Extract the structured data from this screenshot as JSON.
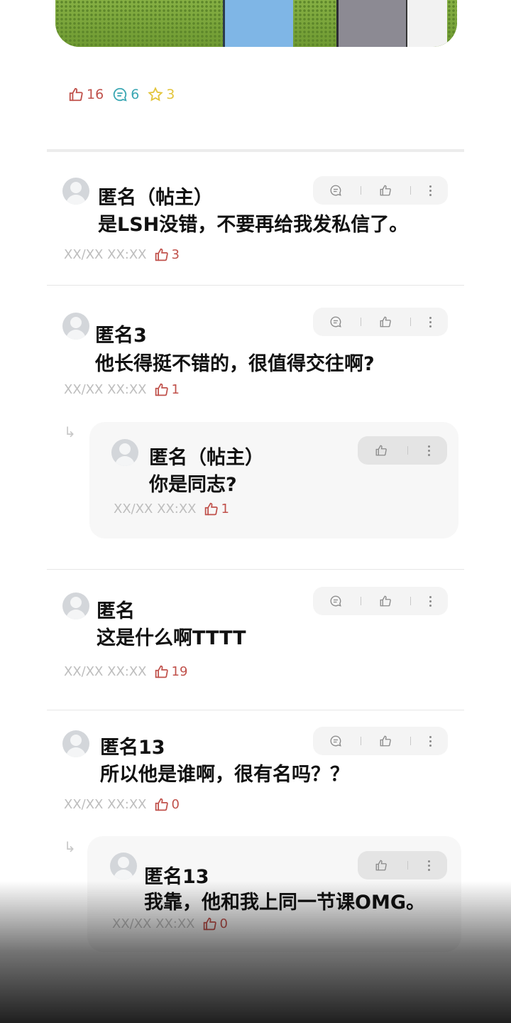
{
  "post_stats": {
    "likes": "16",
    "comments": "6",
    "stars": "3"
  },
  "colors": {
    "like": "#c0514b",
    "comment": "#3aa7b3",
    "star": "#e3c53c",
    "time": "#bdbdbd"
  },
  "comments": [
    {
      "author": "匿名（帖主）",
      "text": "是LSH没错，不要再给我发私信了。",
      "time": "XX/XX XX:XX",
      "likes": "3"
    },
    {
      "author": "匿名3",
      "text": "他长得挺不错的，很值得交往啊?",
      "time": "XX/XX XX:XX",
      "likes": "1",
      "reply": {
        "author": "匿名（帖主）",
        "text": "你是同志?",
        "time": "XX/XX XX:XX",
        "likes": "1"
      }
    },
    {
      "author": "匿名",
      "text": "这是什么啊TTTT",
      "time": "XX/XX XX:XX",
      "likes": "19"
    },
    {
      "author": "匿名13",
      "text": "所以他是谁啊，很有名吗？？",
      "time": "XX/XX XX:XX",
      "likes": "0",
      "reply": {
        "author": "匿名13",
        "text": "我靠，他和我上同一节课OMG。",
        "time": "XX/XX XX:XX",
        "likes": "0"
      }
    }
  ]
}
